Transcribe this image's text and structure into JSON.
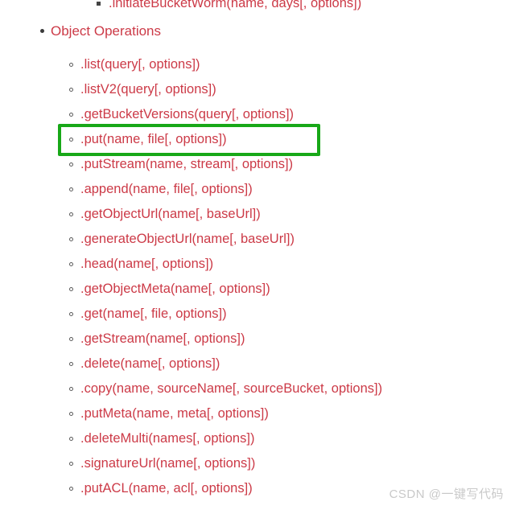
{
  "page": {
    "background_color": "#ffffff",
    "text_color": "#cc3a47",
    "highlight_color": "#18a818",
    "watermark_color": "#c9c9c9"
  },
  "clipped_top_item": {
    "marker": "square-bullet-marker",
    "label": ".initiateBucketWorm(name, days[, options])"
  },
  "section": {
    "marker": "disc-bullet-marker",
    "label": "Object Operations"
  },
  "methods": [
    {
      "label": ".list(query[, options])",
      "highlighted": false
    },
    {
      "label": ".listV2(query[, options])",
      "highlighted": false
    },
    {
      "label": ".getBucketVersions(query[, options])",
      "highlighted": false
    },
    {
      "label": ".put(name, file[, options])",
      "highlighted": true
    },
    {
      "label": ".putStream(name, stream[, options])",
      "highlighted": false
    },
    {
      "label": ".append(name, file[, options])",
      "highlighted": false
    },
    {
      "label": ".getObjectUrl(name[, baseUrl])",
      "highlighted": false
    },
    {
      "label": ".generateObjectUrl(name[, baseUrl])",
      "highlighted": false
    },
    {
      "label": ".head(name[, options])",
      "highlighted": false
    },
    {
      "label": ".getObjectMeta(name[, options])",
      "highlighted": false
    },
    {
      "label": ".get(name[, file, options])",
      "highlighted": false
    },
    {
      "label": ".getStream(name[, options])",
      "highlighted": false
    },
    {
      "label": ".delete(name[, options])",
      "highlighted": false
    },
    {
      "label": ".copy(name, sourceName[, sourceBucket, options])",
      "highlighted": false
    },
    {
      "label": ".putMeta(name, meta[, options])",
      "highlighted": false
    },
    {
      "label": ".deleteMulti(names[, options])",
      "highlighted": false
    },
    {
      "label": ".signatureUrl(name[, options])",
      "highlighted": false
    },
    {
      "label": ".putACL(name, acl[, options])",
      "highlighted": false
    }
  ],
  "watermark": {
    "text": "CSDN @一键写代码"
  }
}
